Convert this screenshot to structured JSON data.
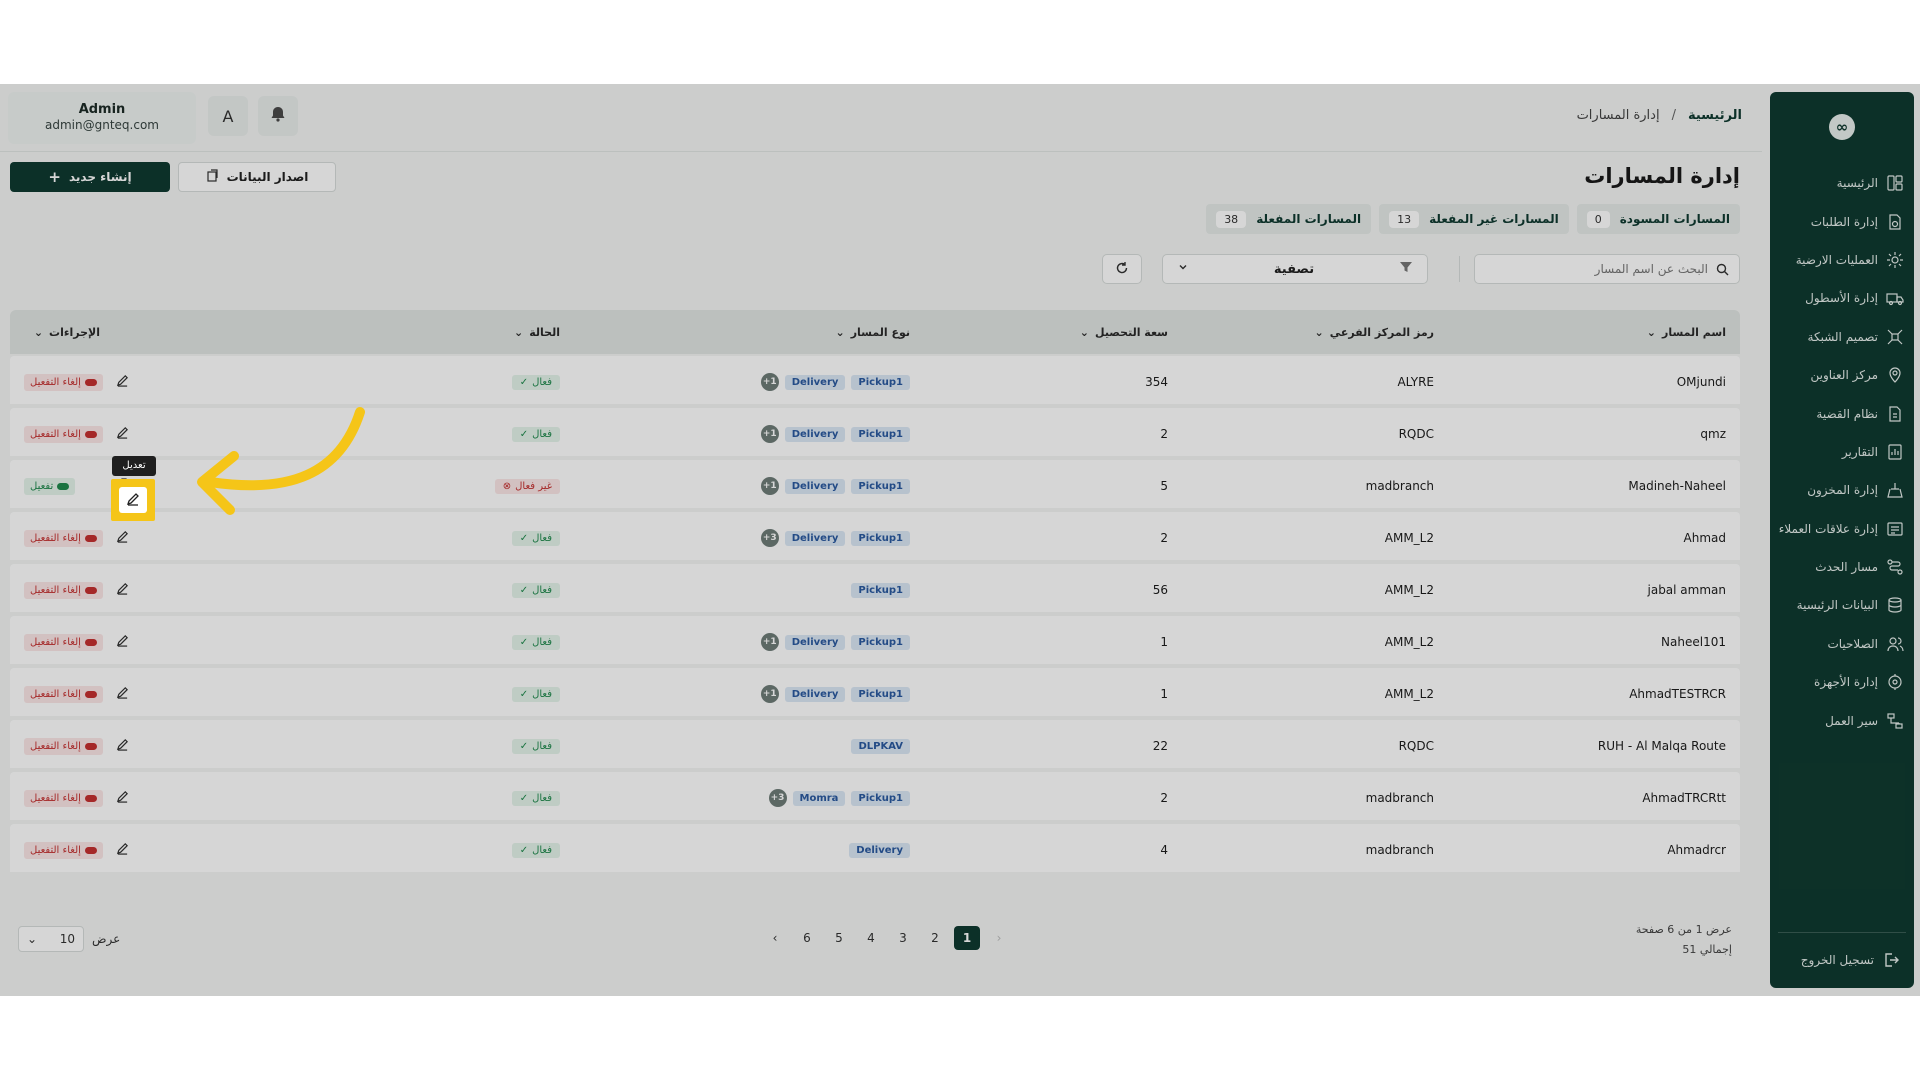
{
  "sidebar": {
    "logo": "∞",
    "items": [
      {
        "label": "الرئيسية",
        "icon": "dashboard-icon"
      },
      {
        "label": "إدارة الطلبات",
        "icon": "orders-icon"
      },
      {
        "label": "العمليات الارضية",
        "icon": "ground-ops-icon"
      },
      {
        "label": "إدارة الأسطول",
        "icon": "truck-icon"
      },
      {
        "label": "تصميم الشبكة",
        "icon": "network-icon"
      },
      {
        "label": "مركز العناوين",
        "icon": "location-icon"
      },
      {
        "label": "نظام القضية",
        "icon": "case-icon"
      },
      {
        "label": "التقارير",
        "icon": "report-icon"
      },
      {
        "label": "إدارة المخزون",
        "icon": "inventory-icon"
      },
      {
        "label": "إدارة علاقات العملاء",
        "icon": "crm-icon"
      },
      {
        "label": "مسار الحدث",
        "icon": "event-path-icon"
      },
      {
        "label": "البيانات الرئيسية",
        "icon": "database-icon"
      },
      {
        "label": "الصلاحيات",
        "icon": "users-icon"
      },
      {
        "label": "إدارة الأجهزة",
        "icon": "device-icon"
      },
      {
        "label": "سير العمل",
        "icon": "workflow-icon"
      }
    ],
    "logout": "تسجيل الخروج"
  },
  "header": {
    "breadcrumb_home": "الرئيسية",
    "breadcrumb_sep": "/",
    "breadcrumb_current": "إدارة المسارات",
    "user_name": "Admin",
    "user_email": "admin@gnteq.com",
    "translate_glyph": "A"
  },
  "page": {
    "title": "إدارة المسارات",
    "create_label": "إنشاء جديد",
    "export_label": "اصدار البيانات"
  },
  "tabs": [
    {
      "label": "المسارات المفعلة",
      "count": "38"
    },
    {
      "label": "المسارات غير المفعلة",
      "count": "13"
    },
    {
      "label": "المسارات المسودة",
      "count": "0"
    }
  ],
  "toolbar": {
    "search_placeholder": "البحث عن اسم المسار",
    "filter_label": "تصفية"
  },
  "table": {
    "headers": {
      "name": "اسم المسار",
      "branch": "رمز المركز الفرعي",
      "capacity": "سعة التحصيل",
      "type": "نوع المسار",
      "status": "الحالة",
      "actions": "الإجراءات"
    },
    "rows": [
      {
        "name": "OMjundi",
        "branch": "ALYRE",
        "capacity": "354",
        "tags": [
          "Pickup1",
          "Delivery"
        ],
        "more": "1+",
        "status": "فعال",
        "active": true,
        "action": "إلغاء التفعيل"
      },
      {
        "name": "qmz",
        "branch": "RQDC",
        "capacity": "2",
        "tags": [
          "Pickup1",
          "Delivery"
        ],
        "more": "1+",
        "status": "فعال",
        "active": true,
        "action": "إلغاء التفعيل"
      },
      {
        "name": "Madineh-Naheel",
        "branch": "madbranch",
        "capacity": "5",
        "tags": [
          "Pickup1",
          "Delivery"
        ],
        "more": "1+",
        "status": "غير فعال",
        "active": false,
        "action": "تفعيل"
      },
      {
        "name": "Ahmad",
        "branch": "AMM_L2",
        "capacity": "2",
        "tags": [
          "Pickup1",
          "Delivery"
        ],
        "more": "3+",
        "status": "فعال",
        "active": true,
        "action": "إلغاء التفعيل"
      },
      {
        "name": "jabal amman",
        "branch": "AMM_L2",
        "capacity": "56",
        "tags": [
          "Pickup1"
        ],
        "more": "",
        "status": "فعال",
        "active": true,
        "action": "إلغاء التفعيل"
      },
      {
        "name": "Naheel101",
        "branch": "AMM_L2",
        "capacity": "1",
        "tags": [
          "Pickup1",
          "Delivery"
        ],
        "more": "1+",
        "status": "فعال",
        "active": true,
        "action": "إلغاء التفعيل"
      },
      {
        "name": "AhmadTESTRCR",
        "branch": "AMM_L2",
        "capacity": "1",
        "tags": [
          "Pickup1",
          "Delivery"
        ],
        "more": "1+",
        "status": "فعال",
        "active": true,
        "action": "إلغاء التفعيل"
      },
      {
        "name": "RUH - Al Malqa Route",
        "branch": "RQDC",
        "capacity": "22",
        "tags": [
          "DLPKAV"
        ],
        "more": "",
        "status": "فعال",
        "active": true,
        "action": "إلغاء التفعيل"
      },
      {
        "name": "AhmadTRCRtt",
        "branch": "madbranch",
        "capacity": "2",
        "tags": [
          "Pickup1",
          "Momra"
        ],
        "more": "3+",
        "status": "فعال",
        "active": true,
        "action": "إلغاء التفعيل"
      },
      {
        "name": "Ahmadrcr",
        "branch": "madbranch",
        "capacity": "4",
        "tags": [
          "Delivery"
        ],
        "more": "",
        "status": "فعال",
        "active": true,
        "action": "إلغاء التفعيل"
      }
    ]
  },
  "tooltip": "تعديل",
  "pagination": {
    "pages": [
      "1",
      "2",
      "3",
      "4",
      "5",
      "6"
    ],
    "current": "1",
    "info_line1": "عرض 1 من 6 صفحة",
    "info_line2": "إجمالي 51",
    "per_page_label": "عرض",
    "per_page_value": "10"
  },
  "colors": {
    "brand": "#0f3a30",
    "highlight": "#f5c518",
    "arrow": "#f5c518",
    "active": "#1f8a4d",
    "inactive": "#c53030"
  }
}
